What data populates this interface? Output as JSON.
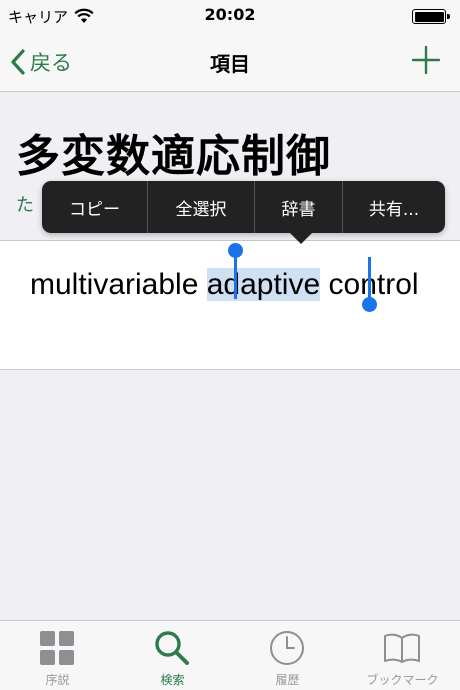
{
  "status_bar": {
    "carrier": "キャリア",
    "time": "20:02"
  },
  "nav": {
    "back_label": "戻る",
    "title": "項目"
  },
  "entry": {
    "title": "多変数適応制御",
    "reading": "た"
  },
  "translation": {
    "before": "multivariable ",
    "selected": "adaptive",
    "after": " control"
  },
  "edit_menu": {
    "items": [
      "コピー",
      "全選択",
      "辞書",
      "共有..."
    ]
  },
  "tabs": [
    {
      "label": "序説",
      "icon": "grid-icon"
    },
    {
      "label": "検索",
      "icon": "search-icon",
      "active": true
    },
    {
      "label": "履歴",
      "icon": "clock-icon"
    },
    {
      "label": "ブックマーク",
      "icon": "book-icon"
    }
  ],
  "colors": {
    "accent": "#2d7a4a",
    "selection": "#1a73e8",
    "inactive": "#999999"
  }
}
